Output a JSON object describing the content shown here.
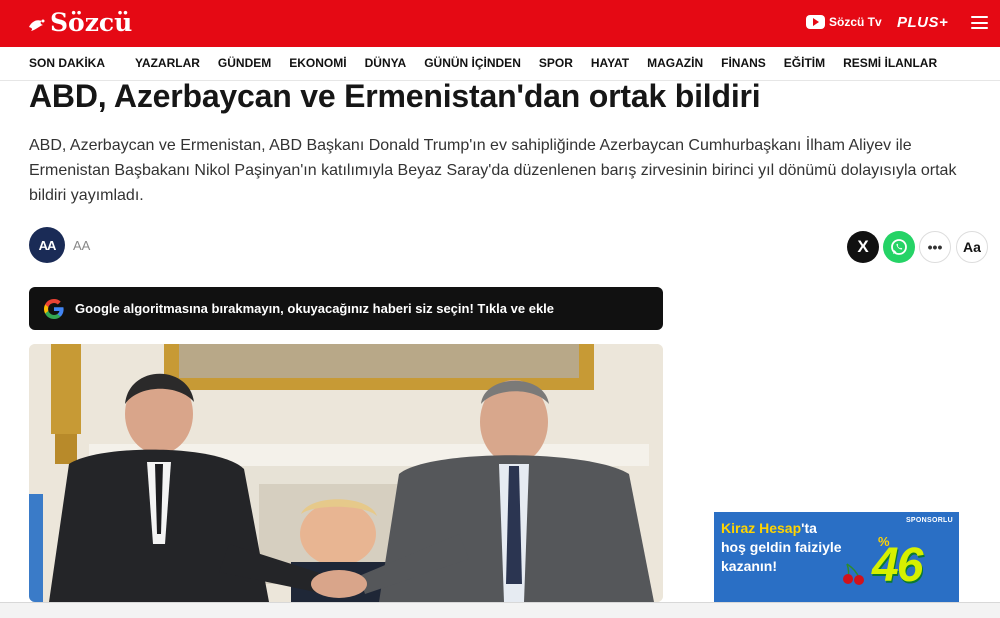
{
  "header": {
    "logo_text": "Sözcü",
    "tv_label": "Sözcü Tv",
    "plus_label": "PLUS+",
    "menu_icon": "hamburger-icon",
    "brand_color": "#e50914"
  },
  "nav": {
    "items": [
      {
        "label": "SON DAKİKA"
      },
      {
        "label": "YAZARLAR"
      },
      {
        "label": "GÜNDEM"
      },
      {
        "label": "EKONOMİ"
      },
      {
        "label": "DÜNYA"
      },
      {
        "label": "GÜNÜN İÇİNDEN"
      },
      {
        "label": "SPOR"
      },
      {
        "label": "HAYAT"
      },
      {
        "label": "MAGAZİN"
      },
      {
        "label": "FİNANS"
      },
      {
        "label": "EĞİTİM"
      },
      {
        "label": "RESMİ İLANLAR"
      }
    ]
  },
  "article": {
    "title": "ABD, Azerbaycan ve Ermenistan'dan ortak bildiri",
    "lead": "ABD, Azerbaycan ve Ermenistan, ABD Başkanı Donald Trump'ın ev sahipliğinde Azerbaycan Cumhurbaşkanı İlham Aliyev ile Ermenistan Başbakanı Nikol Paşinyan'ın katılımıyla Beyaz Saray'da düzenlenen barış zirvesinin birinci yıl dönümü dolayısıyla ortak bildiri yayımladı.",
    "source_logo": "AA",
    "source_name": "AA"
  },
  "share": {
    "x_icon": "x-icon",
    "x_label": "X",
    "whatsapp_icon": "whatsapp-icon",
    "more_icon": "more-icon",
    "more_label": "•••",
    "font_icon": "font-size-icon",
    "font_label": "Aa"
  },
  "google_banner": {
    "icon": "google-icon",
    "text": "Google algoritmasına bırakmayın, okuyacağınız haberi siz seçin! Tıkla ve ekle"
  },
  "photo": {
    "icon": "news-photo"
  },
  "ad": {
    "sponsor_label": "SPONSORLU",
    "brand": "Kiraz Hesap",
    "text_suffix": "'ta",
    "line2": "hoş geldin faiziyle",
    "line3": "kazanın!",
    "percent_sign": "%",
    "rate": "46"
  }
}
